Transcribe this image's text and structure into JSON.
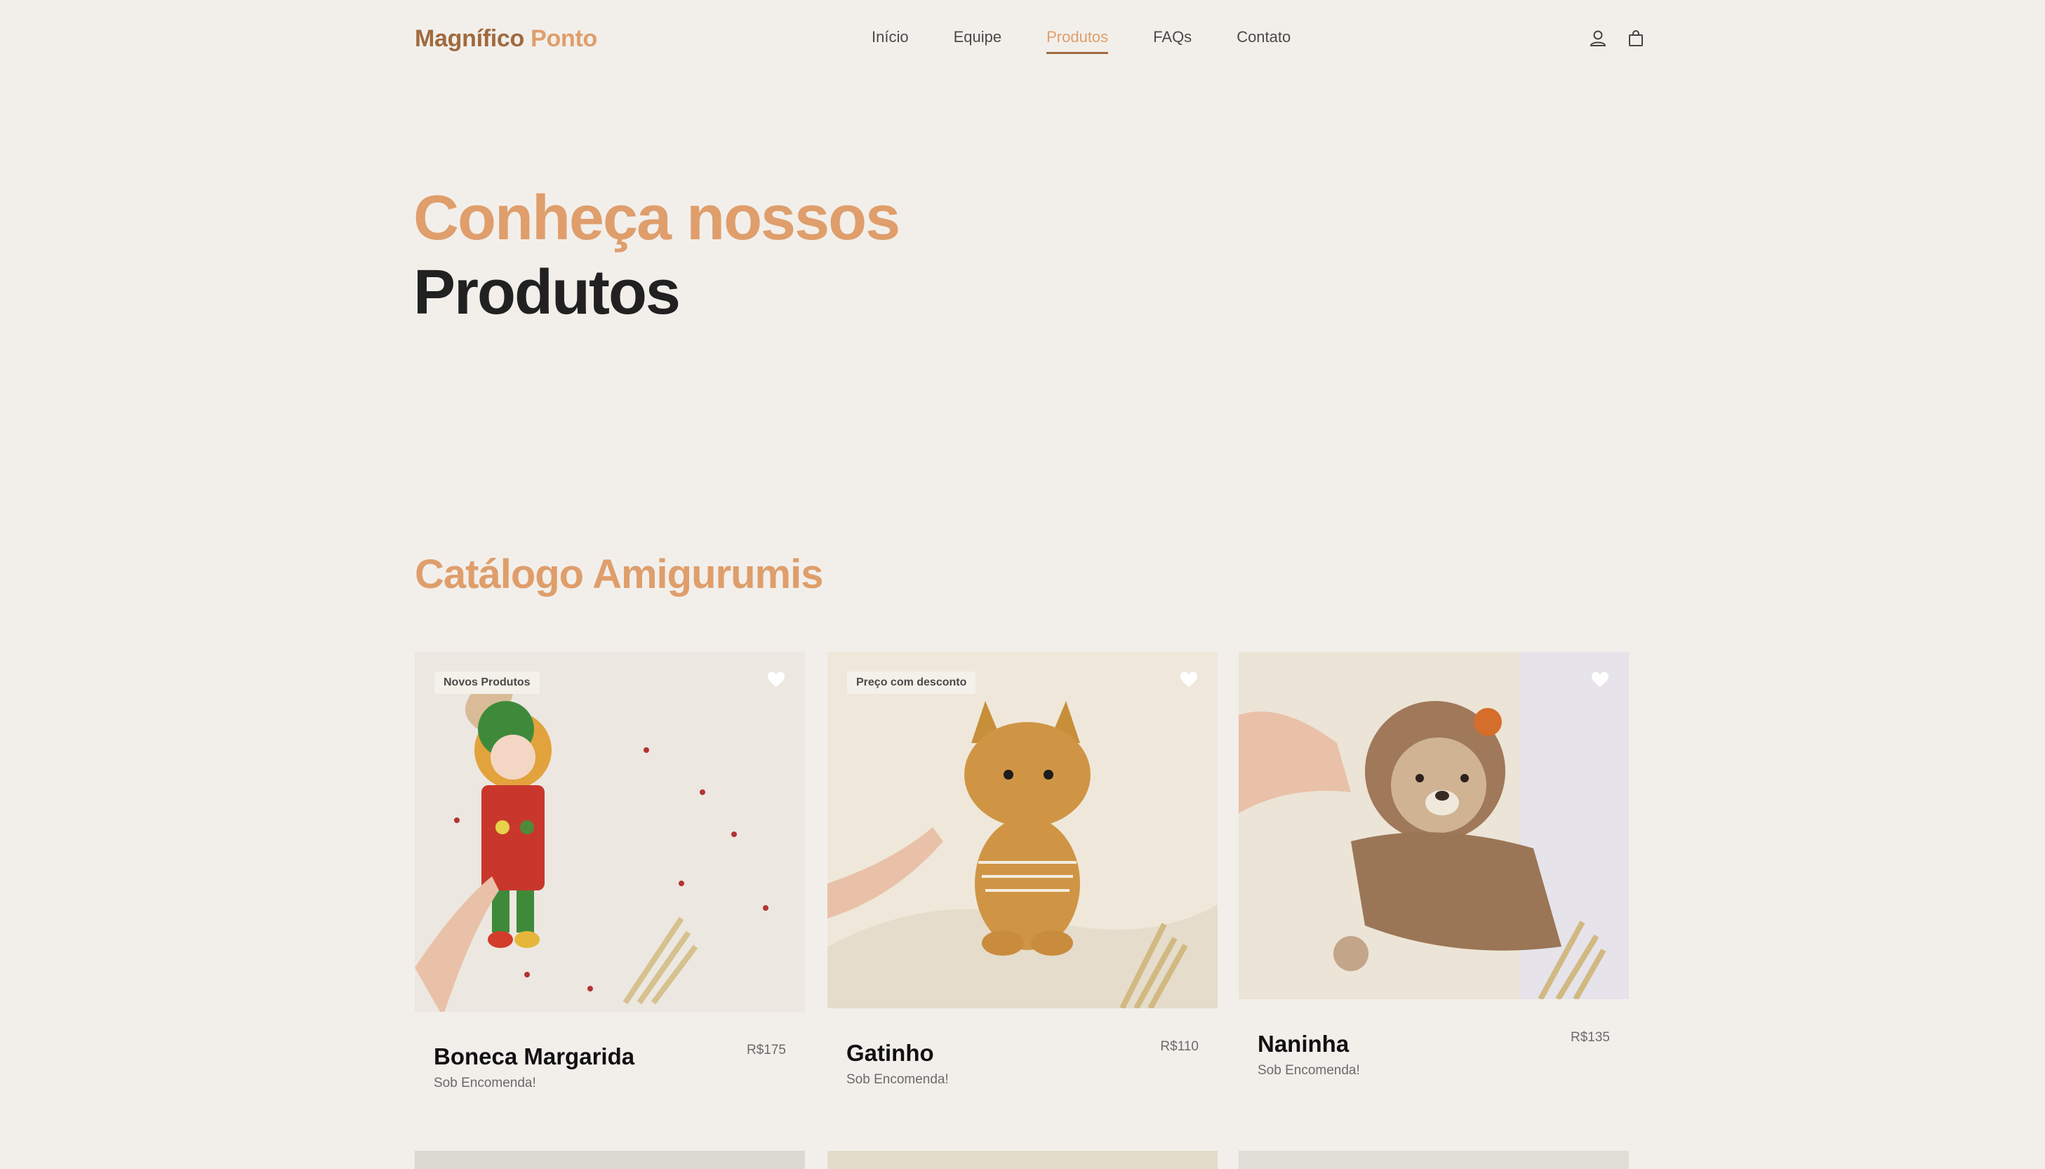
{
  "header": {
    "brand_primary": "Magnífico",
    "brand_accent": "Ponto",
    "nav": [
      {
        "label": "Início"
      },
      {
        "label": "Equipe"
      },
      {
        "label": "Produtos",
        "active": true
      },
      {
        "label": "FAQs"
      },
      {
        "label": "Contato"
      }
    ],
    "icons": [
      "user-icon",
      "shopping-bag-icon"
    ]
  },
  "hero": {
    "line1": "Conheça nossos",
    "line2": "Produtos"
  },
  "catalog": {
    "title": "Catálogo Amigurumis",
    "products": [
      {
        "name": "Boneca Margarida",
        "price": "R$175",
        "status": "Sob Encomenda!",
        "badge": "Novos Produtos"
      },
      {
        "name": "Gatinho",
        "price": "R$110",
        "status": "Sob Encomenda!",
        "badge": "Preço com desconto"
      },
      {
        "name": "Naninha",
        "price": "R$135",
        "status": "Sob Encomenda!",
        "badge": ""
      }
    ]
  },
  "colors": {
    "background": "#f2efeb",
    "accent": "#df9e6b",
    "brand_dark": "#a06a3e",
    "text_dark": "#212121"
  }
}
